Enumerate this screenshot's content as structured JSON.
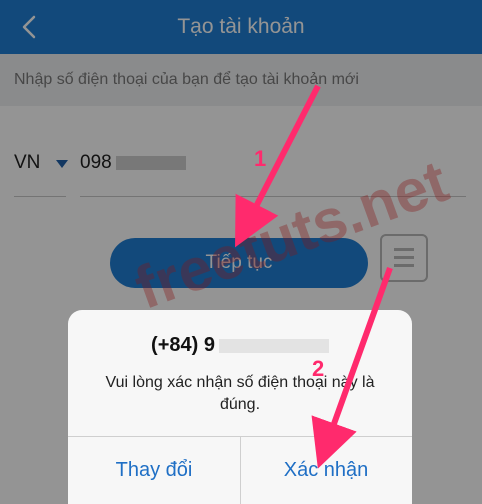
{
  "header": {
    "title": "Tạo tài khoản"
  },
  "subheader": {
    "text": "Nhập số điện thoại của bạn để tạo tài khoản mới"
  },
  "phone_form": {
    "country_code": "VN",
    "phone_value": "098"
  },
  "continue_button": {
    "label": "Tiếp tục"
  },
  "dialog": {
    "number": "(+84) 9",
    "message": "Vui lòng xác nhận số điện thoại này là đúng.",
    "change_label": "Thay đổi",
    "confirm_label": "Xác nhận"
  },
  "annotations": {
    "step1": "1",
    "step2": "2"
  },
  "watermark": "freetuts.net",
  "colors": {
    "accent": "#1f7fd4",
    "arrow": "#ff2a6d"
  }
}
